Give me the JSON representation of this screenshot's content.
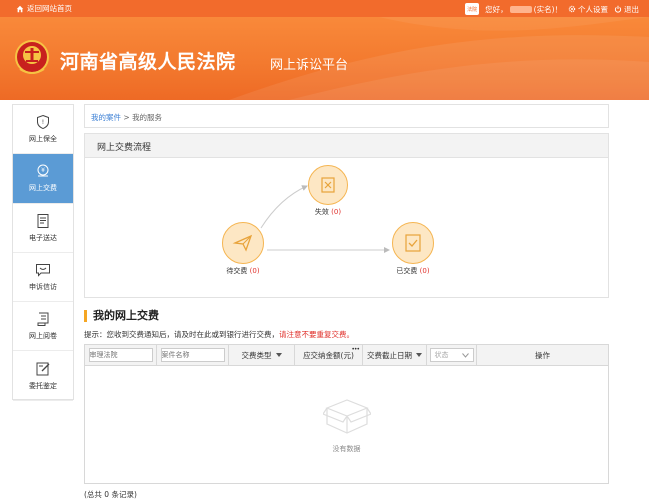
{
  "topbar": {
    "home_label": "返回网站首页",
    "badge": "法院",
    "greeting": "您好，",
    "realname_suffix": "(实名)！",
    "settings_label": "个人设置",
    "logout_label": "退出"
  },
  "header": {
    "court_name": "河南省高级人民法院",
    "platform_name": "网上诉讼平台"
  },
  "sidebar": {
    "items": [
      {
        "label": "网上保全",
        "icon": "shield-icon"
      },
      {
        "label": "网上交费",
        "icon": "coin-icon",
        "active": true
      },
      {
        "label": "电子送达",
        "icon": "document-icon"
      },
      {
        "label": "申诉信访",
        "icon": "message-icon"
      },
      {
        "label": "网上阅卷",
        "icon": "scroll-icon"
      },
      {
        "label": "委托鉴定",
        "icon": "edit-icon"
      }
    ]
  },
  "breadcrumb": {
    "link": "我的案件",
    "separator": " > ",
    "current": "我的服务"
  },
  "flow": {
    "title": "网上交费流程",
    "nodes": {
      "pending": {
        "label": "待交费",
        "count": "(0)"
      },
      "failed": {
        "label": "失效",
        "count": "(0)"
      },
      "paid": {
        "label": "已交费",
        "count": "(0)"
      }
    }
  },
  "section": {
    "title": "我的网上交费",
    "tip_prefix": "提示：您收到交费通知后，请及时在此或到银行进行交费，",
    "tip_warning": "请注意不要重复交费。"
  },
  "table": {
    "filters": {
      "court_placeholder": "审理法院",
      "case_placeholder": "案件名称",
      "status_placeholder": "状态"
    },
    "headers": {
      "fee_type": "交费类型",
      "amount": "应交纳金额(元)",
      "deadline": "交费截止日期",
      "action": "操作"
    },
    "empty_text": "没有数据"
  },
  "footer": {
    "total": "(总共 0 条记录)"
  },
  "colors": {
    "brand_orange": "#f26b2c",
    "active_blue": "#5b9bd5",
    "warning_red": "#e0302b",
    "accent_yellow": "#f5a623"
  }
}
